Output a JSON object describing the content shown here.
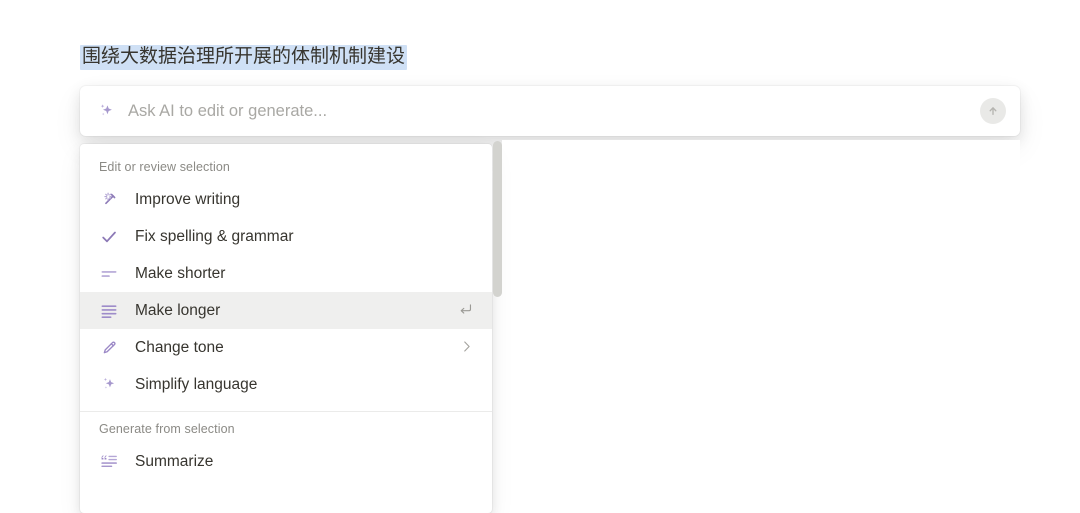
{
  "document": {
    "selected_text": "围绕大数据治理所开展的体制机制建设",
    "selection_highlight_color": "#cfe0f5"
  },
  "ai_bar": {
    "icon": "sparkle-icon",
    "value": "",
    "placeholder": "Ask AI to edit or generate...",
    "submit_icon": "arrow-up-circle-icon"
  },
  "menu": {
    "accent_color": "#9b87c4",
    "active_background": "#efefee",
    "sections": [
      {
        "label": "Edit or review selection",
        "items": [
          {
            "icon": "magic-wand-icon",
            "label": "Improve writing",
            "accessory": "",
            "active": false
          },
          {
            "icon": "check-icon",
            "label": "Fix spelling & grammar",
            "accessory": "",
            "active": false
          },
          {
            "icon": "lines-short-icon",
            "label": "Make shorter",
            "accessory": "",
            "active": false
          },
          {
            "icon": "lines-long-icon",
            "label": "Make longer",
            "accessory": "return-key-icon",
            "active": true
          },
          {
            "icon": "pen-icon",
            "label": "Change tone",
            "accessory": "chevron-right-icon",
            "active": false
          },
          {
            "icon": "sparkle-icon",
            "label": "Simplify language",
            "accessory": "",
            "active": false
          }
        ]
      },
      {
        "label": "Generate from selection",
        "items": [
          {
            "icon": "quote-lines-icon",
            "label": "Summarize",
            "accessory": "",
            "active": false
          }
        ]
      }
    ]
  },
  "scrollbar": {
    "thumb_color": "#d3d3cf"
  }
}
